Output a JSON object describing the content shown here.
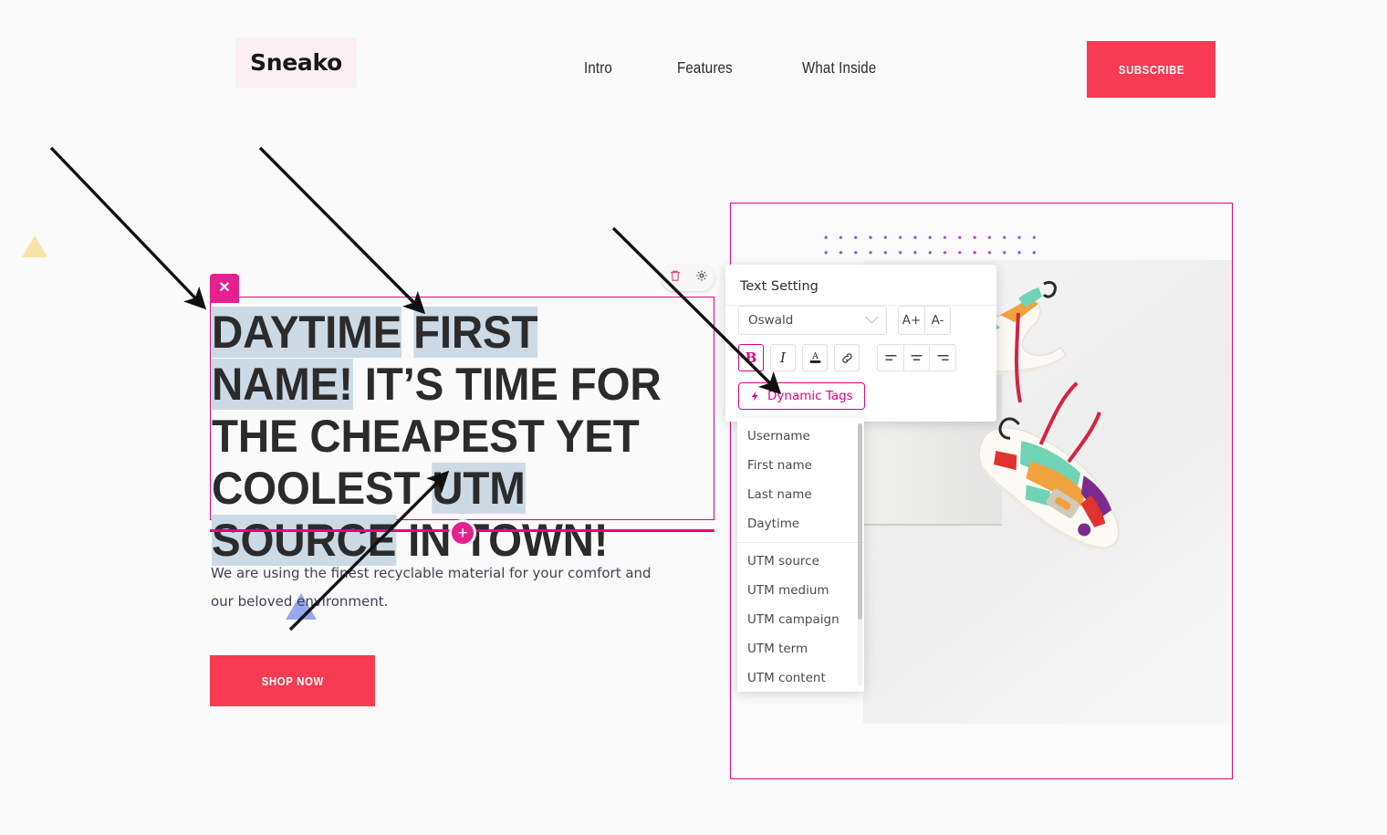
{
  "header": {
    "logo": "Sneako",
    "nav": [
      {
        "label": "Intro"
      },
      {
        "label": "Features"
      },
      {
        "label": "What Inside"
      }
    ],
    "subscribe_label": "SUBSCRIBE"
  },
  "hero": {
    "headline_parts": [
      {
        "text": "DAYTIME",
        "highlight": true
      },
      {
        "text": " ",
        "highlight": false
      },
      {
        "text": "FIRST NAME!",
        "highlight": true
      },
      {
        "text": " IT’S TIME FOR THE CHEAPEST YET COOLEST ",
        "highlight": false
      },
      {
        "text": "UTM SOURCE",
        "highlight": true
      },
      {
        "text": " IN TOWN!",
        "highlight": false
      }
    ],
    "headline_plain": "DAYTIME FIRST NAME! IT’S TIME FOR THE CHEAPEST YET COOLEST UTM SOURCE IN TOWN!",
    "body": "We are using the finest recyclable material for your comfort and our beloved environment.",
    "shop_label": "SHOP NOW",
    "close_glyph": "✕",
    "add_glyph": "+"
  },
  "element_toolbar": {
    "delete_icon": "trash-icon",
    "settings_icon": "gear-icon"
  },
  "text_setting": {
    "title": "Text Setting",
    "font_value": "Oswald",
    "font_increase_label": "A+",
    "font_decrease_label": "A-",
    "bold_label": "B",
    "italic_label": "I",
    "font_color_label": "A",
    "link_icon": "link-icon",
    "align_left_icon": "align-left-icon",
    "align_center_icon": "align-center-icon",
    "align_right_icon": "align-right-icon",
    "dynamic_tags_label": "Dynamic Tags",
    "dynamic_tags_icon": "lightning-bolt-icon"
  },
  "dynamic_tags_menu": {
    "group_one": [
      {
        "label": "Username"
      },
      {
        "label": "First name"
      },
      {
        "label": "Last name"
      },
      {
        "label": "Daytime"
      }
    ],
    "group_two": [
      {
        "label": "UTM source"
      },
      {
        "label": "UTM medium"
      },
      {
        "label": "UTM campaign"
      },
      {
        "label": "UTM term"
      },
      {
        "label": "UTM content"
      }
    ]
  },
  "right_card": {
    "image_alt": "sneaker-product-photo",
    "dot_pattern": "purple-dot-grid"
  },
  "colors": {
    "accent_pink": "#e6007e",
    "accent_magenta": "#e81f8f",
    "cta_red": "#f73b52",
    "highlight_blue": "#ccdae6",
    "logo_bg": "#fceff1",
    "dot_purple": "#a855c8",
    "triangle_yellow": "#f7e3a8",
    "triangle_blue": "#96a9f0",
    "page_bg": "#fafafa"
  }
}
